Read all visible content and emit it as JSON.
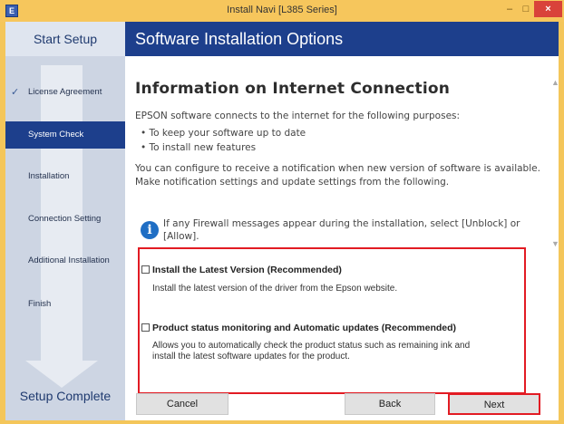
{
  "window": {
    "title": "Install Navi [L385 Series]",
    "minimize_glyph": "–",
    "maximize_glyph": "□",
    "close_glyph": "×"
  },
  "sidebar": {
    "header": "Start Setup",
    "steps": [
      {
        "label": "License Agreement",
        "state": "done"
      },
      {
        "label": "System Check",
        "state": "current"
      },
      {
        "label": "Installation",
        "state": "pending"
      },
      {
        "label": "Connection Setting",
        "state": "pending"
      },
      {
        "label": "Additional Installation",
        "state": "pending"
      },
      {
        "label": "Finish",
        "state": "pending"
      }
    ],
    "footer": "Setup Complete"
  },
  "main": {
    "banner": "Software Installation Options",
    "heading": "Information on Internet Connection",
    "intro": "EPSON software connects to the internet for the following purposes:",
    "bullets": [
      "To keep your software up to date",
      "To install new features"
    ],
    "note_line1": "You can configure to receive a notification when new version of software is available.",
    "note_line2": "Make notification settings and update settings from the following.",
    "info_line1": "If any Firewall messages appear during the installation, select [Unblock] or",
    "info_line2": "[Allow].",
    "info_icon": "i"
  },
  "options": [
    {
      "title": "Install the Latest Version (Recommended)",
      "checked": false,
      "desc_line1": "Install the latest version of the driver from the Epson website.",
      "desc_line2": ""
    },
    {
      "title": "Product status monitoring and Automatic updates (Recommended)",
      "checked": false,
      "desc_line1": "Allows you to automatically check the product status such as remaining ink and",
      "desc_line2": "install the latest software updates for the product."
    }
  ],
  "buttons": {
    "cancel": "Cancel",
    "back": "Back",
    "next": "Next"
  },
  "colors": {
    "title_bar": "#f6c65c",
    "banner": "#1d3f8c",
    "highlight": "#e21b23"
  }
}
